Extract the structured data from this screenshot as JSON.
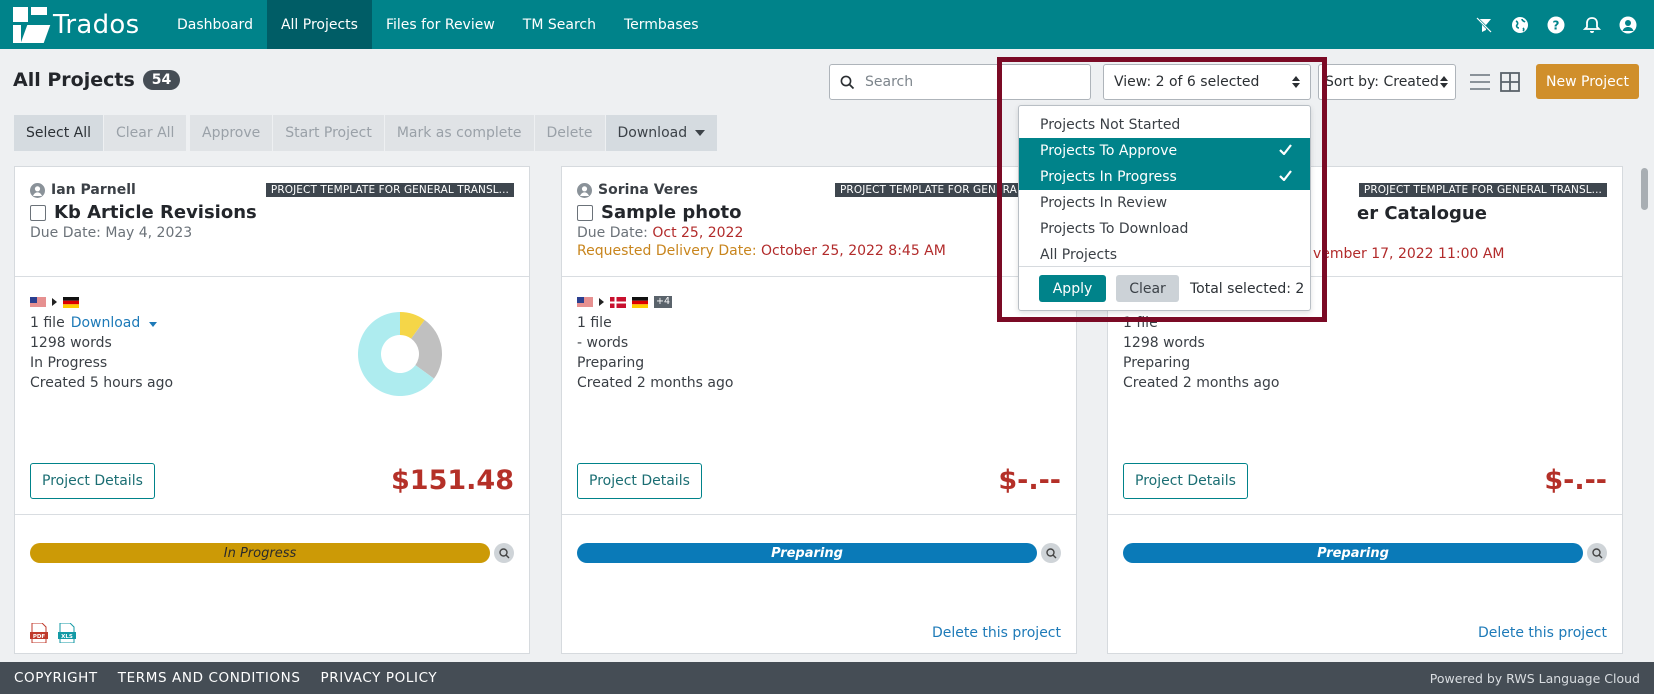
{
  "app": {
    "logo_text": "Trados"
  },
  "nav": {
    "items": [
      {
        "label": "Dashboard",
        "active": false
      },
      {
        "label": "All Projects",
        "active": true
      },
      {
        "label": "Files for Review",
        "active": false
      },
      {
        "label": "TM Search",
        "active": false
      },
      {
        "label": "Termbases",
        "active": false
      }
    ],
    "right_icons": [
      "filter-off-icon",
      "globe-icon",
      "help-icon",
      "bell-icon",
      "user-icon"
    ]
  },
  "header": {
    "title": "All Projects",
    "count": "54",
    "search_placeholder": "Search",
    "view_label": "View: 2 of 6 selected",
    "sort_label": "Sort by: Created",
    "new_project_label": "New Project"
  },
  "toolbar": {
    "select_all": "Select All",
    "clear_all": "Clear All",
    "approve": "Approve",
    "start_project": "Start Project",
    "mark_complete": "Mark as complete",
    "delete": "Delete",
    "download": "Download"
  },
  "view_dropdown": {
    "options": [
      {
        "label": "Projects Not Started",
        "selected": false
      },
      {
        "label": "Projects To Approve",
        "selected": true
      },
      {
        "label": "Projects In Progress",
        "selected": true
      },
      {
        "label": "Projects In Review",
        "selected": false
      },
      {
        "label": "Projects To Download",
        "selected": false
      },
      {
        "label": "All Projects",
        "selected": false
      }
    ],
    "apply": "Apply",
    "clear": "Clear",
    "total": "Total selected: 2"
  },
  "cards": [
    {
      "owner": "Ian Parnell",
      "template": "PROJECT TEMPLATE FOR GENERAL TRANSL...",
      "title": "Kb Article Revisions",
      "due_prefix": "Due Date: ",
      "due": "May 4, 2023",
      "files": "1 file",
      "download": "Download",
      "words": "1298 words",
      "status": "In Progress",
      "created": "Created 5 hours ago",
      "details": "Project Details",
      "price": "$151.48",
      "bar_label": "In Progress"
    },
    {
      "owner": "Sorina Veres",
      "template": "PROJECT TEMPLATE FOR GENERAL TR",
      "title": "Sample photo",
      "due_prefix": "Due Date: ",
      "due": "Oct 25, 2022",
      "req_prefix": "Requested Delivery Date: ",
      "req": "October 25, 2022 8:45 AM",
      "extra_langs": "+4",
      "files": "1 file",
      "words": "- words",
      "status": "Preparing",
      "created": "Created 2 months ago",
      "details": "Project Details",
      "price": "$-.--",
      "bar_label": "Preparing",
      "delete_link": "Delete this project"
    },
    {
      "template": "PROJECT TEMPLATE FOR GENERAL TRANSL...",
      "title_partial": "er Catalogue",
      "req_partial": "vember 17, 2022 11:00 AM",
      "files": "1 file",
      "words": "1298 words",
      "status": "Preparing",
      "created": "Created 2 months ago",
      "details": "Project Details",
      "price": "$-.--",
      "bar_label": "Preparing",
      "delete_link": "Delete this project"
    }
  ],
  "donut_chart": {
    "segments": [
      {
        "color": "#f5d648",
        "fraction": 0.1
      },
      {
        "color": "#c0c0c0",
        "fraction": 0.25
      },
      {
        "color": "#aeecef",
        "fraction": 0.65
      }
    ]
  },
  "footer": {
    "copyright": "COPYRIGHT",
    "terms": "TERMS AND CONDITIONS",
    "privacy": "PRIVACY POLICY",
    "powered": "Powered by RWS Language Cloud"
  },
  "colors": {
    "brand": "#00838a",
    "accent": "#d08f2b",
    "price": "#b43028",
    "highlight": "#7b0a25"
  }
}
